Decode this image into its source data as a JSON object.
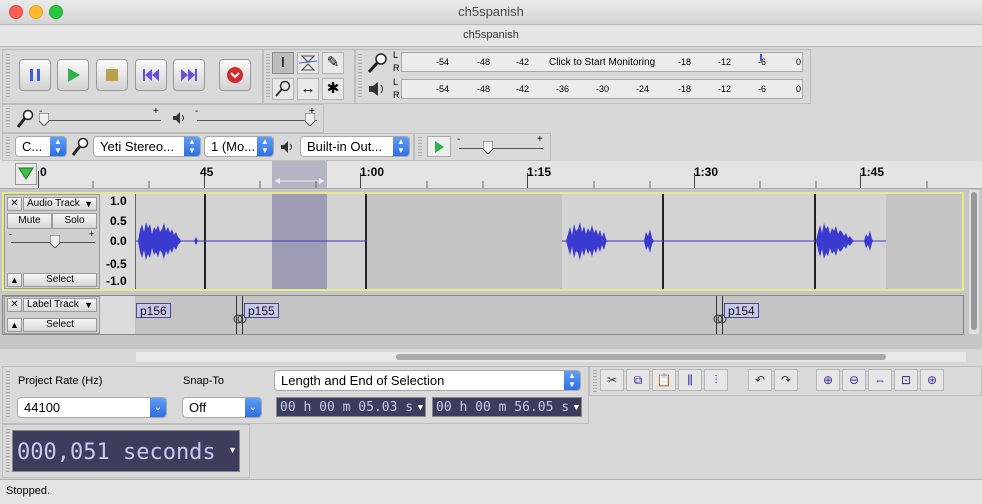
{
  "window": {
    "title": "ch5spanish",
    "document_title": "ch5spanish"
  },
  "transport": {
    "buttons": [
      "pause-button",
      "play-button",
      "stop-button",
      "skip-start-button",
      "skip-end-button",
      "record-button"
    ]
  },
  "meters": {
    "record_label_top": "L",
    "record_label_bottom": "R",
    "record_ticks": [
      "-54",
      "-48",
      "-42",
      "-18",
      "-12",
      "-6",
      "0"
    ],
    "monitor_text": "Click to Start Monitoring",
    "play_label_top": "L",
    "play_label_bottom": "R",
    "play_ticks": [
      "-54",
      "-48",
      "-42",
      "-36",
      "-30",
      "-24",
      "-18",
      "-12",
      "-6",
      "0"
    ]
  },
  "mixer": {
    "rec_plus": "+",
    "rec_minus": "-",
    "play_plus": "+",
    "play_minus": "-"
  },
  "device": {
    "host": "C...",
    "input_device": "Yeti Stereo...",
    "channels": "1 (Mo...",
    "output_device": "Built-in Out...",
    "speed_plus": "+",
    "speed_minus": "-"
  },
  "ruler": {
    "labels": [
      "0",
      "45",
      "1:00",
      "1:15",
      "1:30",
      "1:45"
    ]
  },
  "audio_track": {
    "name": "Audio Track",
    "mute": "Mute",
    "solo": "Solo",
    "select": "Select",
    "gain_plus": "+",
    "gain_minus": "-",
    "scale": [
      "1.0",
      "0.5",
      "0.0",
      "-0.5",
      "-1.0"
    ]
  },
  "label_track": {
    "name": "Label Track",
    "select": "Select",
    "labels": [
      "p156",
      "p155",
      "p154"
    ]
  },
  "selection": {
    "project_rate_label": "Project Rate (Hz)",
    "project_rate": "44100",
    "snap_to_label": "Snap-To",
    "snap_to": "Off",
    "mode": "Length and End of Selection",
    "start_time": "00 h 00 m 05.03 s",
    "end_time": "00 h 00 m 56.05 s"
  },
  "audio_position": {
    "value": "000,051 seconds"
  },
  "status": {
    "text": "Stopped."
  },
  "colors": {
    "waveform": "#3a3ad0",
    "selection": "#9c9cb4",
    "label_bg": "#c8c8ec"
  }
}
